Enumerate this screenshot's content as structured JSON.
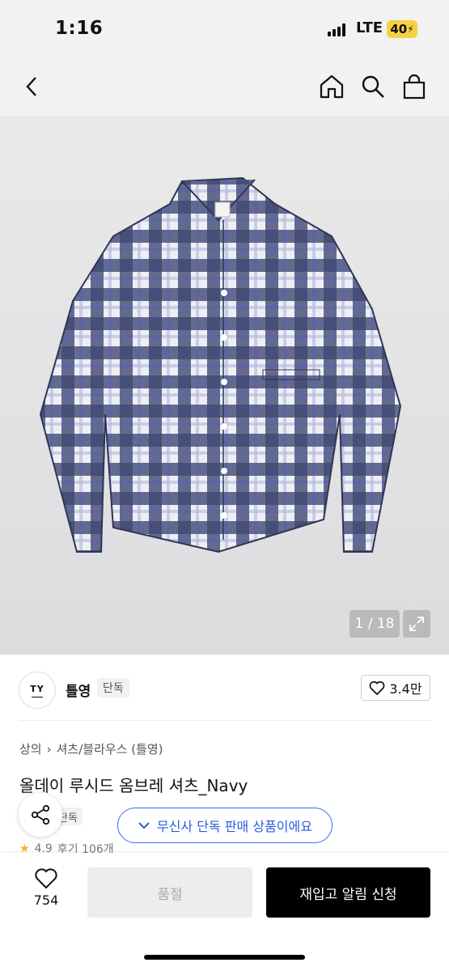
{
  "status": {
    "time": "1:16",
    "network": "LTE",
    "battery": "40"
  },
  "nav": {
    "back_icon": "chevron-left-icon",
    "home_icon": "home-icon",
    "search_icon": "search-icon",
    "bag_icon": "shopping-bag-icon"
  },
  "gallery": {
    "counter": "1 / 18",
    "expand_icon": "expand-icon"
  },
  "brand": {
    "logo_text": "TY",
    "name": "틀영",
    "badge": "단독",
    "likes": "3.4만"
  },
  "breadcrumb": {
    "category": "상의",
    "subcategory": "셔츠/블라우스 (틀영)"
  },
  "product": {
    "title": "올데이 루시드 옴브레 셔츠_Navy",
    "badge": "단독"
  },
  "exclusive_pill": "무신사 단독 판매 상품이에요",
  "rating": {
    "score": "4.9",
    "reviews": "후기 106개"
  },
  "actions": {
    "wish_count": "754",
    "soldout": "품절",
    "notify": "재입고 알림 신청"
  },
  "colors": {
    "accent_blue": "#2a5ce0",
    "star": "#f2b01e",
    "battery": "#f5d142"
  }
}
